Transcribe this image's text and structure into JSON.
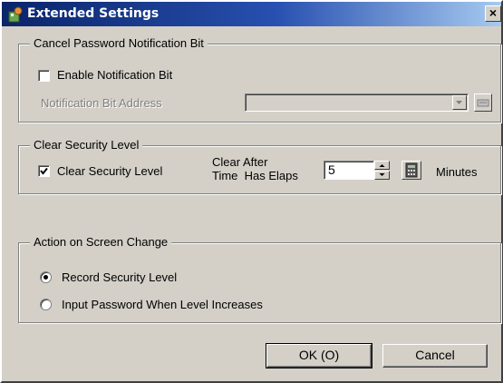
{
  "window": {
    "title": "Extended Settings",
    "close_glyph": "×",
    "icon": "app-settings-icon"
  },
  "cancel_password_group": {
    "legend": "Cancel Password Notification Bit",
    "enable_checkbox": {
      "label": "Enable Notification Bit",
      "checked": false
    },
    "address_label": "Notification Bit Address",
    "address_value": "",
    "address_enabled": false
  },
  "clear_security_group": {
    "legend": "Clear Security Level",
    "checkbox": {
      "label": "Clear Security Level",
      "checked": true
    },
    "time_label_line1": "Clear After",
    "time_label_line2": "Time  Has Elaps",
    "time_value": "5",
    "unit_label": "Minutes"
  },
  "screen_change_group": {
    "legend": "Action on Screen Change",
    "options": [
      {
        "label": "Record Security Level",
        "selected": true
      },
      {
        "label": "Input Password When Level Increases",
        "selected": false
      }
    ]
  },
  "buttons": {
    "ok": "OK (O)",
    "cancel": "Cancel"
  }
}
